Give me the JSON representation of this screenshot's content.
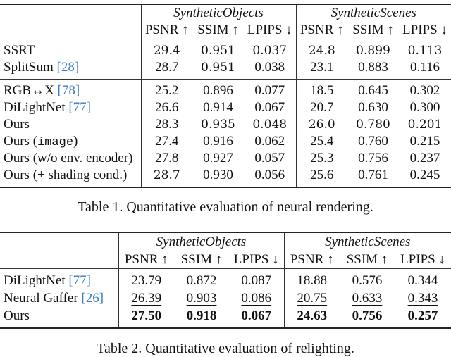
{
  "table1": {
    "groups": [
      "SyntheticObjects",
      "SyntheticScenes"
    ],
    "metrics": [
      "PSNR ↑",
      "SSIM ↑",
      "LPIPS ↓",
      "PSNR ↑",
      "SSIM ↑",
      "LPIPS ↓"
    ],
    "sections": [
      [
        {
          "name": "SSRT",
          "cite": "",
          "values": [
            "29.4",
            "0.951",
            "0.037",
            "24.8",
            "0.899",
            "0.113"
          ],
          "bold": [
            true,
            true,
            true,
            true,
            true,
            true
          ]
        },
        {
          "name": "SplitSum ",
          "cite": "[28]",
          "values": [
            "28.7",
            "0.951",
            "0.038",
            "23.1",
            "0.883",
            "0.116"
          ],
          "bold": [
            false,
            true,
            false,
            false,
            false,
            false
          ]
        }
      ],
      [
        {
          "name": "RGB↔X ",
          "cite": "[78]",
          "values": [
            "25.2",
            "0.896",
            "0.077",
            "18.5",
            "0.645",
            "0.302"
          ],
          "bold": [
            false,
            false,
            false,
            false,
            false,
            false
          ]
        },
        {
          "name": "DiLightNet ",
          "cite": "[77]",
          "values": [
            "26.6",
            "0.914",
            "0.067",
            "20.7",
            "0.630",
            "0.300"
          ],
          "bold": [
            false,
            false,
            false,
            false,
            false,
            false
          ]
        },
        {
          "name": "Ours",
          "cite": "",
          "values": [
            "28.3",
            "0.935",
            "0.048",
            "26.0",
            "0.780",
            "0.201"
          ],
          "bold": [
            false,
            true,
            true,
            true,
            true,
            true
          ]
        },
        {
          "name": "Ours (",
          "mono": "image",
          "suffix": ")",
          "values": [
            "27.4",
            "0.916",
            "0.062",
            "25.4",
            "0.760",
            "0.215"
          ],
          "bold": [
            false,
            false,
            false,
            false,
            false,
            false
          ]
        },
        {
          "name": "Ours (w/o env. encoder)",
          "cite": "",
          "values": [
            "27.8",
            "0.927",
            "0.057",
            "25.3",
            "0.756",
            "0.237"
          ],
          "bold": [
            false,
            false,
            false,
            false,
            false,
            false
          ]
        },
        {
          "name": "Ours (+ shading cond.)",
          "cite": "",
          "values": [
            "28.7",
            "0.930",
            "0.056",
            "25.6",
            "0.761",
            "0.245"
          ],
          "bold": [
            true,
            false,
            false,
            false,
            false,
            false
          ]
        }
      ]
    ],
    "caption": "Table 1. Quantitative evaluation of neural rendering."
  },
  "table2": {
    "groups": [
      "SyntheticObjects",
      "SyntheticScenes"
    ],
    "metrics": [
      "PSNR ↑",
      "SSIM ↑",
      "LPIPS ↓",
      "PSNR ↑",
      "SSIM ↑",
      "LPIPS ↓"
    ],
    "rows": [
      {
        "name": "DiLightNet ",
        "cite": "[77]",
        "values": [
          "23.79",
          "0.872",
          "0.087",
          "18.88",
          "0.576",
          "0.344"
        ],
        "style": [
          "",
          "",
          "",
          "",
          "",
          ""
        ]
      },
      {
        "name": "Neural Gaffer ",
        "cite": "[26]",
        "values": [
          "26.39",
          "0.903",
          "0.086",
          "20.75",
          "0.633",
          "0.343"
        ],
        "style": [
          "u",
          "u",
          "u",
          "u",
          "u",
          "u"
        ]
      },
      {
        "name": "Ours",
        "cite": "",
        "values": [
          "27.50",
          "0.918",
          "0.067",
          "24.63",
          "0.756",
          "0.257"
        ],
        "style": [
          "b",
          "b",
          "b",
          "b",
          "b",
          "b"
        ]
      }
    ],
    "caption": "Table 2. Quantitative evaluation of relighting."
  }
}
